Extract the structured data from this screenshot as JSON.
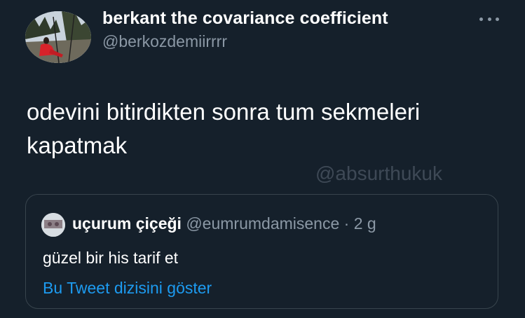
{
  "tweet": {
    "author_name": "berkant the covariance coefficient",
    "author_handle": "@berkozdemiirrrr",
    "more_icon": "more-horizontal-icon",
    "text": "odevini bitirdikten sonra tum sekmeleri\nkapatmak"
  },
  "watermark": "@absurthukuk",
  "quoted_tweet": {
    "author_name": "uçurum çiçeği",
    "meta": "@eumrumdamisence · 2 g",
    "text": "güzel bir his tarif et",
    "show_thread_link": "Bu Tweet dizisini göster"
  },
  "colors": {
    "background": "#15202b",
    "secondary_text": "#8b98a5",
    "border": "#38444d",
    "link": "#1d9bf0"
  }
}
